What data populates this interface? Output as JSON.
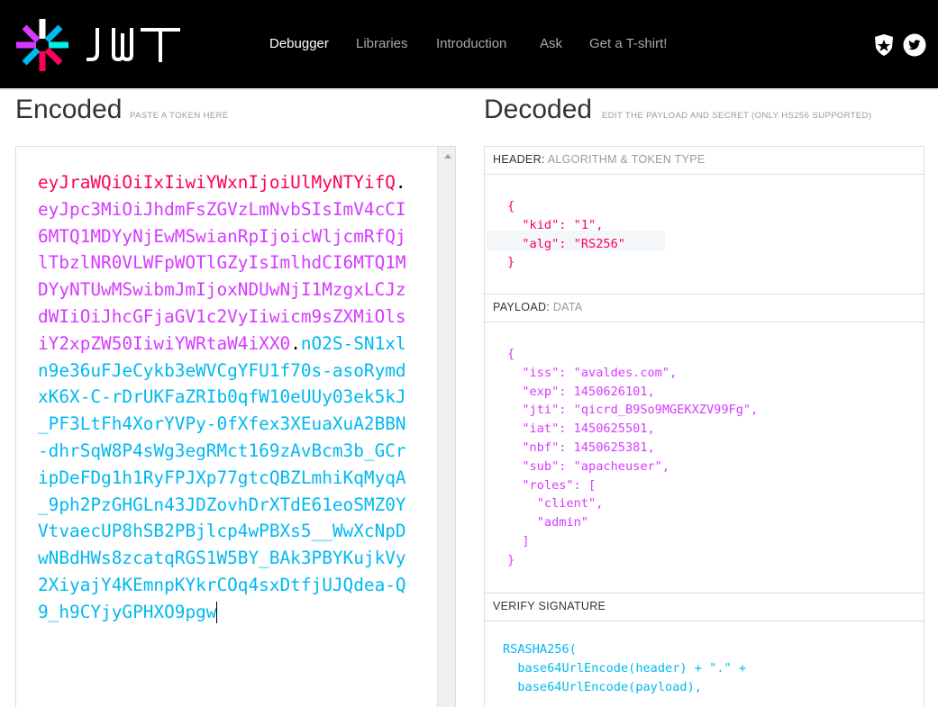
{
  "app": {
    "colors": {
      "header": "#fb015b",
      "payload": "#d63aff",
      "signature": "#00b9f1"
    }
  },
  "nav": {
    "items": [
      "Debugger",
      "Libraries",
      "Introduction",
      "Ask",
      "Get a T-shirt!"
    ],
    "active": "Debugger"
  },
  "encoded": {
    "title": "Encoded",
    "subtitle": "PASTE A TOKEN HERE",
    "token_header": "eyJraWQiOiIxIiwiYWxnIjoiUlMyNTYifQ",
    "dot1": ".",
    "token_payload": "eyJpc3MiOiJhdmFsZGVzLmNvbSIsImV4cCI6MTQ1MDYyNjEwMSwianRpIjoicWljcmRfQjlTbzlNR0VLWFpWOTlGZyIsImlhdCI6MTQ1MDYyNTUwMSwibmJmIjoxNDUwNjI1MzgxLCJzdWIiOiJhcGFjaGV1c2VyIiwicm9sZXMiOlsiY2xpZW50IiwiYWRtaW4iXX0",
    "dot2": ".",
    "token_signature": "nO2S-SN1xln9e36uFJeCykb3eWVCgYFU1f70s-asoRymdxK6X-C-rDrUKFaZRIb0qfW10eUUy03ek5kJ_PF3LtFh4XorYVPy-0fXfex3XEuaXuA2BBN-dhrSqW8P4sWg3egRMct169zAvBcm3b_GCripDeFDg1h1RyFPJXp77gtcQBZLmhiKqMyqA_9ph2PzGHGLn43JDZovhDrXTdE61eoSMZ0YVtvaecUP8hSB2PBjlcp4wPBXs5__WwXcNpDwNBdHWs8zcatqRGS1W5BY_BAk3PBYKujkVy2XiyajY4KEmnpKYkrCOq4sxDtfjUJQdea-Q9_h9CYjyGPHXO9pgw"
  },
  "decoded": {
    "title": "Decoded",
    "subtitle": "EDIT THE PAYLOAD AND SECRET (ONLY HS256 SUPPORTED)",
    "header_section": {
      "label": "HEADER:",
      "muted": "ALGORITHM & TOKEN TYPE"
    },
    "header_json": "{\n  \"kid\": \"1\",\n  \"alg\": \"RS256\"\n}",
    "payload_section": {
      "label": "PAYLOAD:",
      "muted": "DATA"
    },
    "payload_json": "{\n  \"iss\": \"avaldes.com\",\n  \"exp\": 1450626101,\n  \"jti\": \"qicrd_B9So9MGEKXZV99Fg\",\n  \"iat\": 1450625501,\n  \"nbf\": 1450625381,\n  \"sub\": \"apacheuser\",\n  \"roles\": [\n    \"client\",\n    \"admin\"\n  ]\n}",
    "signature_section": {
      "label": "VERIFY SIGNATURE"
    },
    "signature_code": "RSASHA256(\n  base64UrlEncode(header) + \".\" +\n  base64UrlEncode(payload),"
  }
}
